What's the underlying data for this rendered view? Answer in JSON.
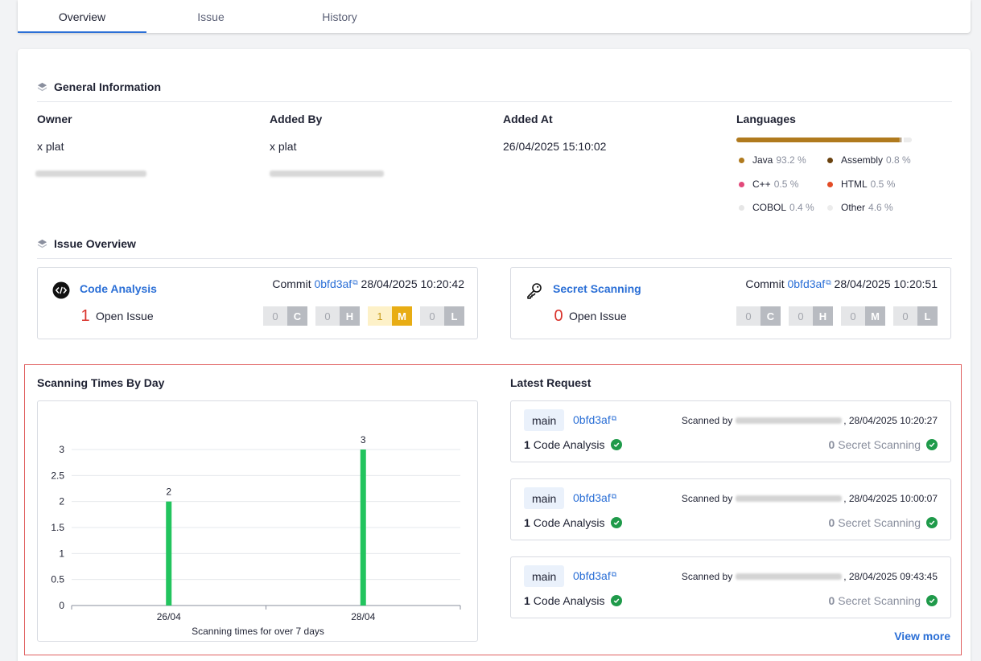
{
  "tabs": [
    {
      "label": "Overview",
      "active": true
    },
    {
      "label": "Issue",
      "active": false
    },
    {
      "label": "History",
      "active": false
    }
  ],
  "general": {
    "title": "General Information",
    "owner_label": "Owner",
    "owner_name": "x plat",
    "added_by_label": "Added By",
    "added_by_name": "x plat",
    "added_at_label": "Added At",
    "added_at_value": "26/04/2025 15:10:02",
    "languages_label": "Languages",
    "languages": [
      {
        "name": "Java",
        "pct": "93.2 %",
        "value": 93.2,
        "color": "#b07a1e"
      },
      {
        "name": "Assembly",
        "pct": "0.8 %",
        "value": 0.8,
        "color": "#6b4310"
      },
      {
        "name": "C++",
        "pct": "0.5 %",
        "value": 0.5,
        "color": "#e2497a"
      },
      {
        "name": "HTML",
        "pct": "0.5 %",
        "value": 0.5,
        "color": "#e34c26"
      },
      {
        "name": "COBOL",
        "pct": "0.4 %",
        "value": 0.4,
        "color": "#e6e6e6"
      },
      {
        "name": "Other",
        "pct": "4.6 %",
        "value": 4.6,
        "color": "#ececec"
      }
    ]
  },
  "issue_overview": {
    "title": "Issue Overview",
    "code": {
      "title": "Code Analysis",
      "commit_label": "Commit",
      "commit_hash": "0bfd3af",
      "commit_time": "28/04/2025 10:20:42",
      "count": "1",
      "open_label": "Open Issue",
      "severity": [
        {
          "num": "0",
          "letter": "C"
        },
        {
          "num": "0",
          "letter": "H"
        },
        {
          "num": "1",
          "letter": "M"
        },
        {
          "num": "0",
          "letter": "L"
        }
      ]
    },
    "secret": {
      "title": "Secret Scanning",
      "commit_label": "Commit",
      "commit_hash": "0bfd3af",
      "commit_time": "28/04/2025 10:20:51",
      "count": "0",
      "open_label": "Open Issue",
      "severity": [
        {
          "num": "0",
          "letter": "C"
        },
        {
          "num": "0",
          "letter": "H"
        },
        {
          "num": "0",
          "letter": "M"
        },
        {
          "num": "0",
          "letter": "L"
        }
      ]
    }
  },
  "scanning_chart": {
    "title": "Scanning Times By Day",
    "caption": "Scanning times for over 7 days"
  },
  "chart_data": {
    "type": "bar",
    "categories": [
      "26/04",
      "28/04"
    ],
    "values": [
      2,
      3
    ],
    "yticks": [
      "0",
      "0.5",
      "1",
      "1.5",
      "2",
      "2.5",
      "3"
    ],
    "ylim": [
      0,
      3
    ],
    "xlabel": "Scanning times for over 7 days",
    "ylabel": "",
    "grid": true,
    "bar_color": "#22c45e"
  },
  "latest": {
    "title": "Latest Request",
    "view_more": "View more",
    "requests": [
      {
        "branch": "main",
        "commit": "0bfd3af",
        "scanned_by": "Scanned by",
        "time": ", 28/04/2025 10:20:27",
        "code_count": "1",
        "code_label": "Code Analysis",
        "secret_count": "0",
        "secret_label": "Secret Scanning"
      },
      {
        "branch": "main",
        "commit": "0bfd3af",
        "scanned_by": "Scanned by",
        "time": ", 28/04/2025 10:00:07",
        "code_count": "1",
        "code_label": "Code Analysis",
        "secret_count": "0",
        "secret_label": "Secret Scanning"
      },
      {
        "branch": "main",
        "commit": "0bfd3af",
        "scanned_by": "Scanned by",
        "time": ", 28/04/2025 09:43:45",
        "code_count": "1",
        "code_label": "Code Analysis",
        "secret_count": "0",
        "secret_label": "Secret Scanning"
      }
    ]
  }
}
